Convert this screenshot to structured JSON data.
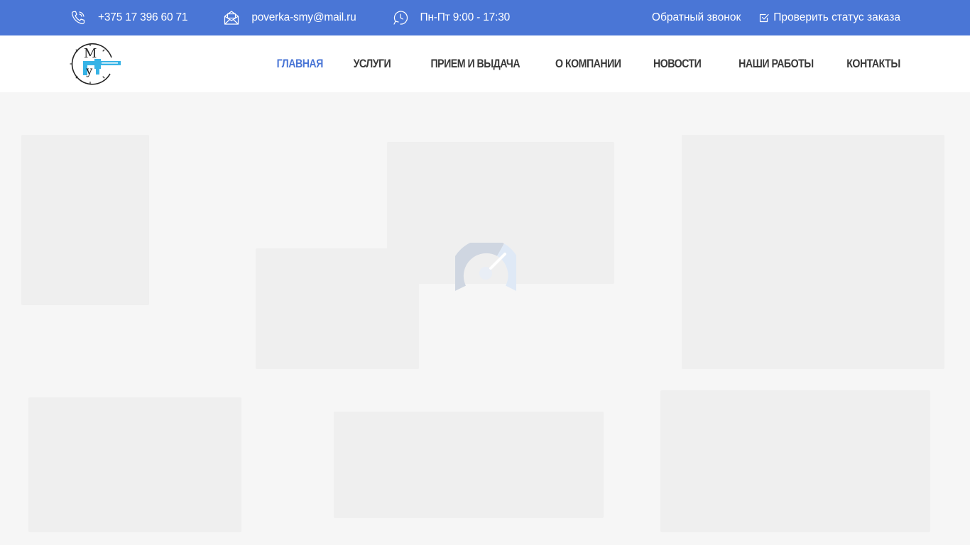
{
  "colors": {
    "brand": "#4a76d6",
    "nav_text": "#3a3a3a",
    "logo_accent": "#36b3e6"
  },
  "topbar": {
    "phone": {
      "icon": "phone-icon",
      "text": "+375 17 396 60 71"
    },
    "email": {
      "icon": "mail-icon",
      "text": "poverka-smy@mail.ru"
    },
    "hours": {
      "icon": "clock-icon",
      "text": "Пн-Пт 9:00 - 17:30"
    },
    "callback_label": "Обратный звонок",
    "order_status": {
      "icon": "checkbox-icon",
      "label": "Проверить статус заказа"
    }
  },
  "logo": {
    "letters": "МУ"
  },
  "nav": {
    "items": [
      {
        "label": "ГЛАВНАЯ",
        "active": true
      },
      {
        "label": "УСЛУГИ"
      },
      {
        "label": "ПРИЕМ И ВЫДАЧА"
      },
      {
        "label": "О КОМПАНИИ"
      },
      {
        "label": "НОВОСТИ"
      },
      {
        "label": "НАШИ РАБОТЫ"
      },
      {
        "label": "КОНТАКТЫ"
      }
    ]
  },
  "hero": {
    "state": "loading",
    "loader_icon": "loading-spinner-icon"
  }
}
